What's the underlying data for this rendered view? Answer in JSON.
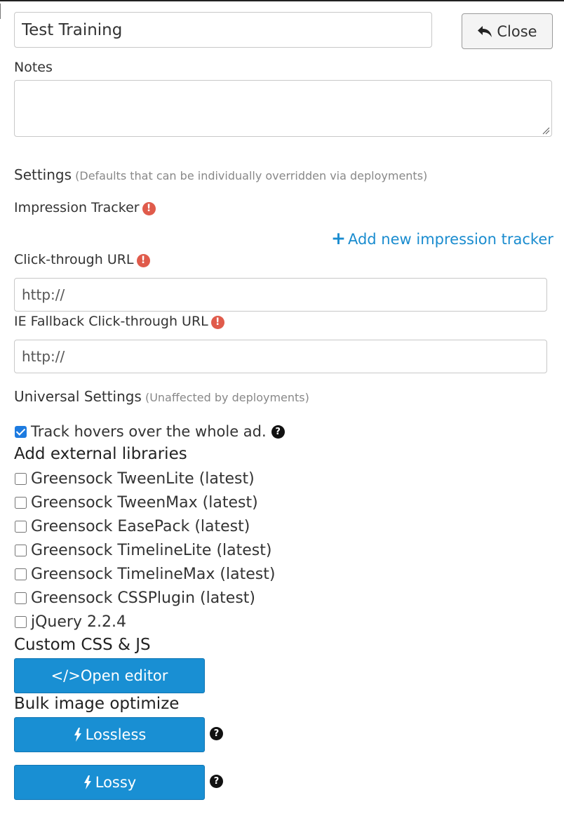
{
  "training": {
    "name": "Test Training",
    "close_label": "Close"
  },
  "notes": {
    "label": "Notes",
    "value": ""
  },
  "settings": {
    "title": "Settings",
    "subtitle": "(Defaults that can be individually overridden via deployments)",
    "impression_tracker_label": "Impression Tracker",
    "add_tracker_label": "Add new impression tracker",
    "click_through_label": "Click-through URL",
    "click_through_value": "http://",
    "ie_fallback_label": "IE Fallback Click-through URL",
    "ie_fallback_value": "http://"
  },
  "universal": {
    "title": "Universal Settings",
    "subtitle": "(Unaffected by deployments)",
    "track_hovers_label": "Track hovers over the whole ad.",
    "track_hovers_checked": true
  },
  "libraries": {
    "heading": "Add external libraries",
    "items": [
      {
        "label": "Greensock TweenLite (latest)",
        "checked": false
      },
      {
        "label": "Greensock TweenMax (latest)",
        "checked": false
      },
      {
        "label": "Greensock EasePack (latest)",
        "checked": false
      },
      {
        "label": "Greensock TimelineLite (latest)",
        "checked": false
      },
      {
        "label": "Greensock TimelineMax (latest)",
        "checked": false
      },
      {
        "label": "Greensock CSSPlugin (latest)",
        "checked": false
      },
      {
        "label": "jQuery 2.2.4",
        "checked": false
      }
    ]
  },
  "custom_code": {
    "heading": "Custom CSS & JS",
    "open_editor_label": "</>Open editor"
  },
  "bulk_optimize": {
    "heading": "Bulk image optimize",
    "lossless_label": "Lossless",
    "lossy_label": "Lossy"
  },
  "colors": {
    "primary": "#198fd3",
    "link": "#1a8ccf",
    "warning": "#e05b4b",
    "checkbox": "#1d7be0",
    "text": "#333333",
    "muted": "#888888"
  },
  "icons": {
    "close": "reply-arrow-icon",
    "warning": "exclamation-circle-icon",
    "add": "plus-icon",
    "help": "question-circle-icon",
    "lightning": "lightning-bolt-icon"
  },
  "glyphs": {
    "warning": "!",
    "help": "?",
    "plus": "+"
  }
}
